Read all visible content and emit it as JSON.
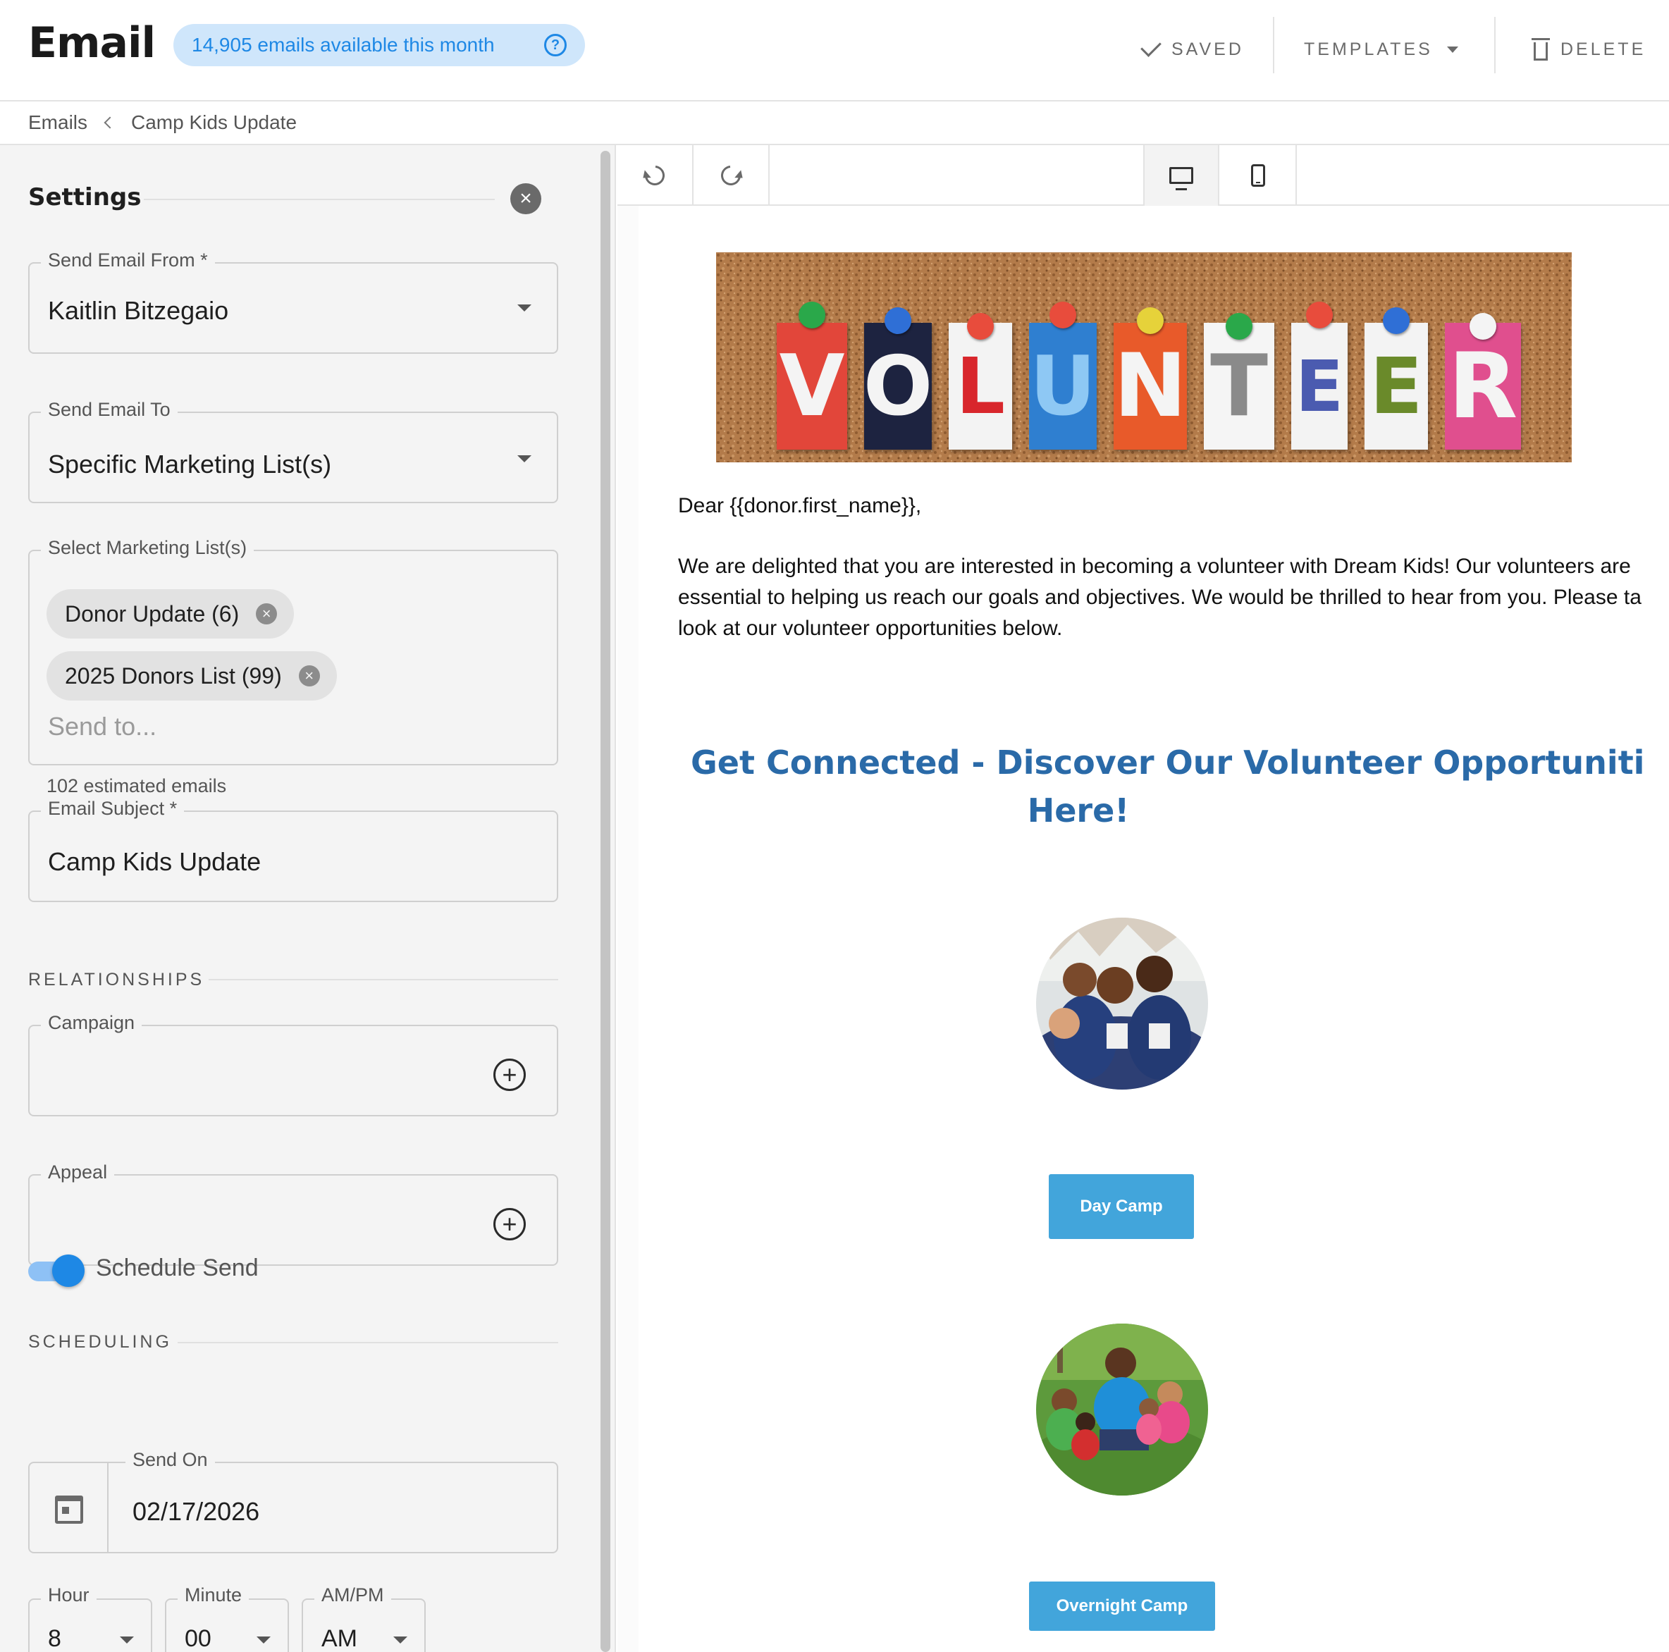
{
  "header": {
    "app_title": "Email",
    "quota": "14,905 emails available this month",
    "saved_label": "SAVED",
    "templates_label": "TEMPLATES",
    "delete_label": "DELETE"
  },
  "breadcrumb": {
    "root": "Emails",
    "current": "Camp Kids Update"
  },
  "settings": {
    "title": "Settings",
    "send_from": {
      "label": "Send Email From *",
      "value": "Kaitlin Bitzegaio"
    },
    "send_to": {
      "label": "Send Email To",
      "value": "Specific Marketing List(s)"
    },
    "lists": {
      "label": "Select Marketing List(s)",
      "chips": [
        "Donor Update (6)",
        "2025 Donors List (99)"
      ],
      "placeholder": "Send to...",
      "estimate": "102 estimated emails"
    },
    "subject": {
      "label": "Email Subject *",
      "value": "Camp Kids Update"
    },
    "relationships_heading": "RELATIONSHIPS",
    "campaign_label": "Campaign",
    "appeal_label": "Appeal",
    "scheduling_heading": "SCHEDULING",
    "schedule_toggle": {
      "label": "Schedule Send",
      "on": true
    },
    "send_on": {
      "label": "Send On",
      "value": "02/17/2026"
    },
    "hour": {
      "label": "Hour",
      "value": "8"
    },
    "minute": {
      "label": "Minute",
      "value": "00"
    },
    "ampm": {
      "label": "AM/PM",
      "value": "AM"
    }
  },
  "editor": {
    "view_mode": "desktop",
    "email": {
      "banner_word": "VOLUNTEER",
      "greeting": "Dear {{donor.first_name}},",
      "intro_lines": [
        "We are delighted that you are interested in becoming a volunteer with Dream Kids! Our volunteers are",
        "essential to helping us reach our goals and objectives. We would be thrilled to hear from you. Please ta",
        "look at our volunteer opportunities below."
      ],
      "heading_lines": [
        "Get Connected - Discover Our Volunteer Opportuniti",
        "Here!"
      ],
      "buttons": [
        "Day Camp",
        "Overnight Camp"
      ]
    }
  },
  "colors": {
    "accent": "#1e88e5",
    "heading_blue": "#2a6aa8",
    "button_blue": "#42a5db"
  }
}
